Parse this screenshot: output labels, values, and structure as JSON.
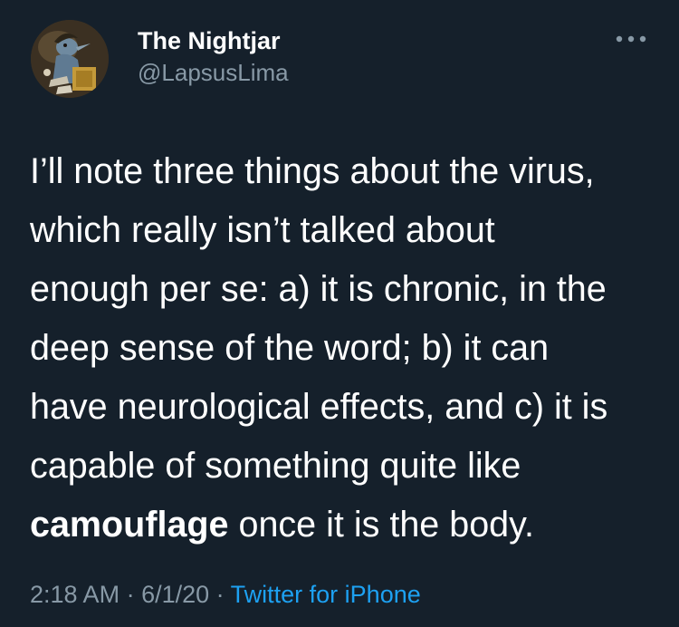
{
  "author": {
    "name": "The Nightjar",
    "handle": "@LapsusLima"
  },
  "tweet": {
    "lines": [
      "I’ll note three things about the virus,",
      "which really isn’t talked about",
      "enough per se: a) it is chronic, in the",
      "deep sense of the word; b) it can",
      "have neurological effects, and c) it is",
      "capable of something quite like"
    ],
    "bold_word": "camouflage",
    "last_line_rest": " once it is the body."
  },
  "meta": {
    "time": "2:18 AM",
    "separator": " · ",
    "date": "6/1/20",
    "separator2": " · ",
    "source": "Twitter for iPhone"
  },
  "icons": {
    "more": "more-icon"
  },
  "colors": {
    "background": "#15202b",
    "text": "#ffffff",
    "secondary": "#8899a6",
    "link": "#1da1f2"
  }
}
